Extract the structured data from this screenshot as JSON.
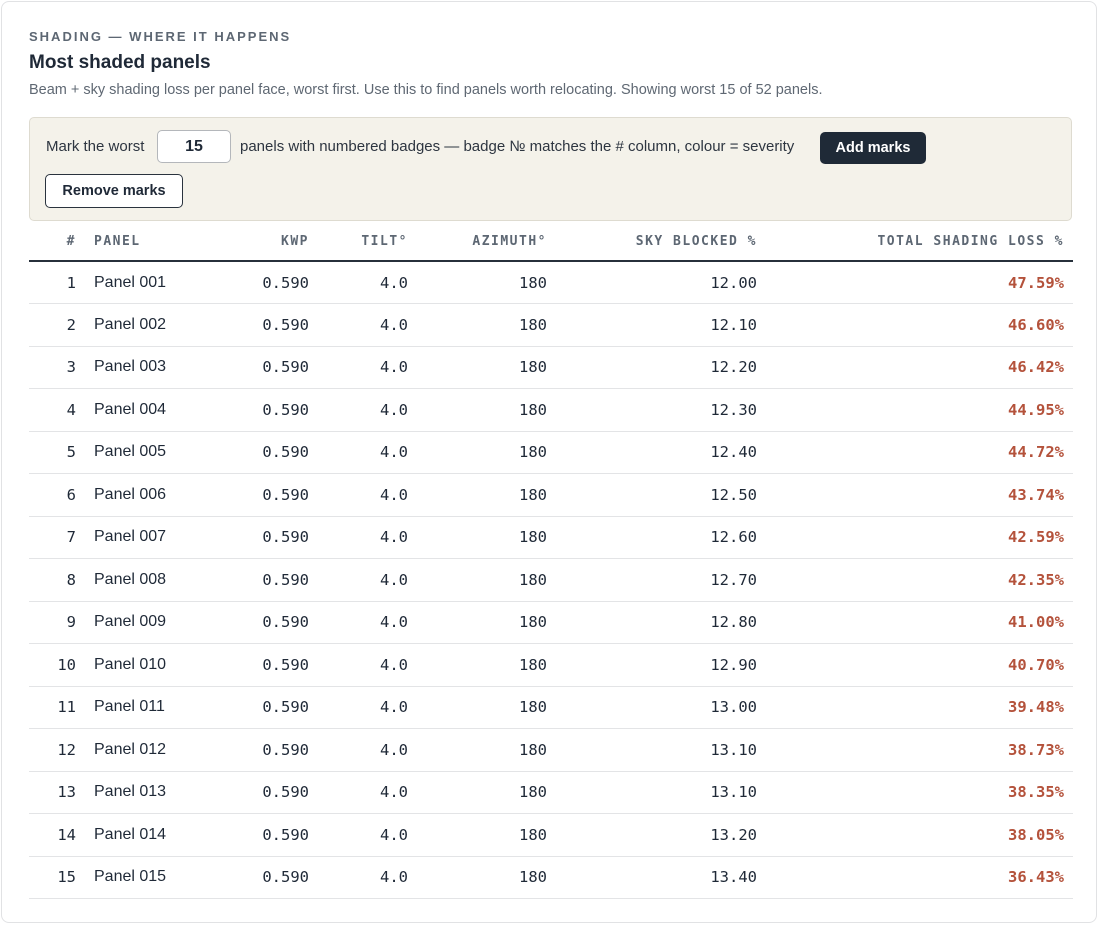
{
  "header": {
    "eyebrow": "SHADING — WHERE IT HAPPENS",
    "title": "Most shaded panels",
    "subtitle": "Beam + sky shading loss per panel face, worst first. Use this to find panels worth relocating. Showing worst 15 of 52 panels."
  },
  "controls": {
    "mark_prefix": "Mark the worst",
    "mark_count": "15",
    "mark_suffix": "panels with numbered badges — badge № matches the # column, colour = severity",
    "add_label": "Add marks",
    "remove_label": "Remove marks"
  },
  "table": {
    "columns": [
      "#",
      "PANEL",
      "KWP",
      "TILT°",
      "AZIMUTH°",
      "SKY BLOCKED %",
      "TOTAL SHADING LOSS %"
    ],
    "rows": [
      {
        "rank": "1",
        "panel": "Panel 001",
        "kwp": "0.590",
        "tilt": "4.0",
        "azimuth": "180",
        "sky_blocked": "12.00",
        "loss": "47.59%"
      },
      {
        "rank": "2",
        "panel": "Panel 002",
        "kwp": "0.590",
        "tilt": "4.0",
        "azimuth": "180",
        "sky_blocked": "12.10",
        "loss": "46.60%"
      },
      {
        "rank": "3",
        "panel": "Panel 003",
        "kwp": "0.590",
        "tilt": "4.0",
        "azimuth": "180",
        "sky_blocked": "12.20",
        "loss": "46.42%"
      },
      {
        "rank": "4",
        "panel": "Panel 004",
        "kwp": "0.590",
        "tilt": "4.0",
        "azimuth": "180",
        "sky_blocked": "12.30",
        "loss": "44.95%"
      },
      {
        "rank": "5",
        "panel": "Panel 005",
        "kwp": "0.590",
        "tilt": "4.0",
        "azimuth": "180",
        "sky_blocked": "12.40",
        "loss": "44.72%"
      },
      {
        "rank": "6",
        "panel": "Panel 006",
        "kwp": "0.590",
        "tilt": "4.0",
        "azimuth": "180",
        "sky_blocked": "12.50",
        "loss": "43.74%"
      },
      {
        "rank": "7",
        "panel": "Panel 007",
        "kwp": "0.590",
        "tilt": "4.0",
        "azimuth": "180",
        "sky_blocked": "12.60",
        "loss": "42.59%"
      },
      {
        "rank": "8",
        "panel": "Panel 008",
        "kwp": "0.590",
        "tilt": "4.0",
        "azimuth": "180",
        "sky_blocked": "12.70",
        "loss": "42.35%"
      },
      {
        "rank": "9",
        "panel": "Panel 009",
        "kwp": "0.590",
        "tilt": "4.0",
        "azimuth": "180",
        "sky_blocked": "12.80",
        "loss": "41.00%"
      },
      {
        "rank": "10",
        "panel": "Panel 010",
        "kwp": "0.590",
        "tilt": "4.0",
        "azimuth": "180",
        "sky_blocked": "12.90",
        "loss": "40.70%"
      },
      {
        "rank": "11",
        "panel": "Panel 011",
        "kwp": "0.590",
        "tilt": "4.0",
        "azimuth": "180",
        "sky_blocked": "13.00",
        "loss": "39.48%"
      },
      {
        "rank": "12",
        "panel": "Panel 012",
        "kwp": "0.590",
        "tilt": "4.0",
        "azimuth": "180",
        "sky_blocked": "13.10",
        "loss": "38.73%"
      },
      {
        "rank": "13",
        "panel": "Panel 013",
        "kwp": "0.590",
        "tilt": "4.0",
        "azimuth": "180",
        "sky_blocked": "13.10",
        "loss": "38.35%"
      },
      {
        "rank": "14",
        "panel": "Panel 014",
        "kwp": "0.590",
        "tilt": "4.0",
        "azimuth": "180",
        "sky_blocked": "13.20",
        "loss": "38.05%"
      },
      {
        "rank": "15",
        "panel": "Panel 015",
        "kwp": "0.590",
        "tilt": "4.0",
        "azimuth": "180",
        "sky_blocked": "13.40",
        "loss": "36.43%"
      }
    ]
  },
  "colors": {
    "loss_text": "#b4523b",
    "primary_button": "#1f2a37",
    "controls_background": "#f4f2ea"
  }
}
